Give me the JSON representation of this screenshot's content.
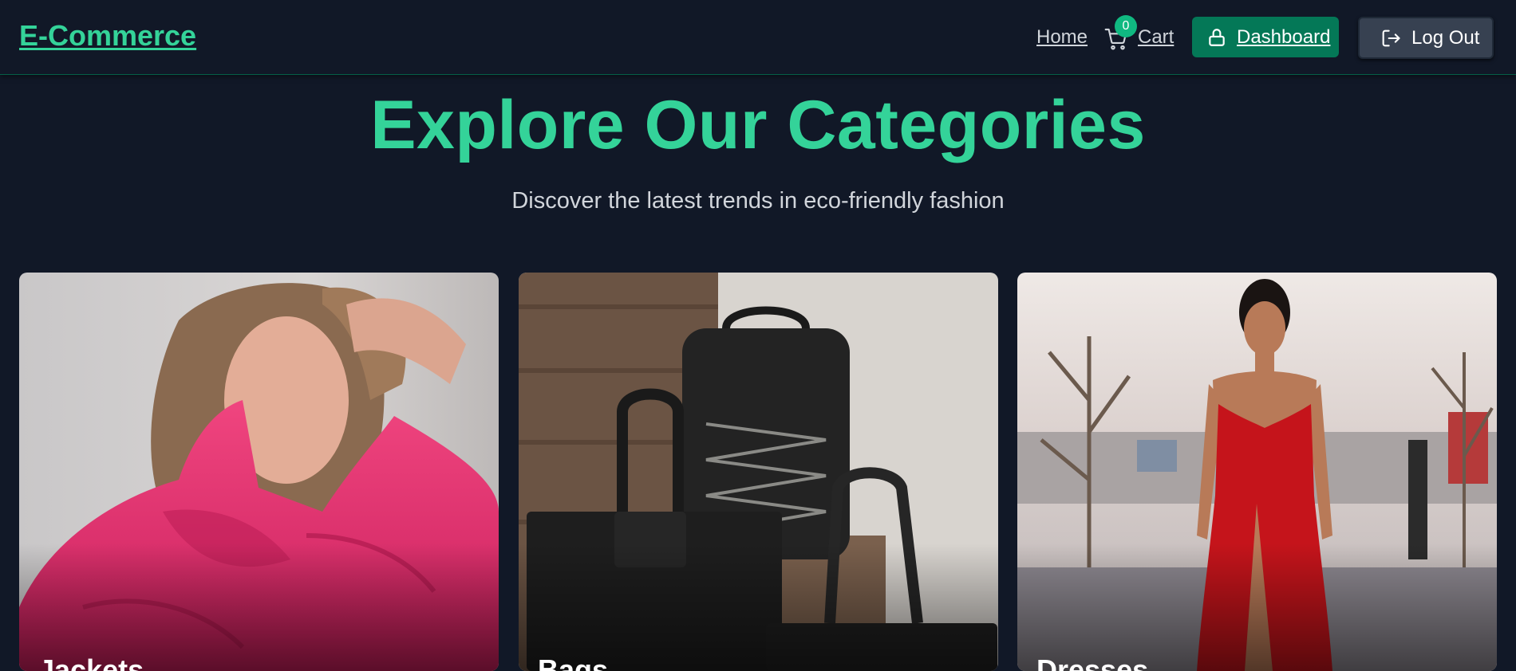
{
  "header": {
    "logo": "E-Commerce",
    "nav": {
      "home": "Home",
      "cart_label": "Cart",
      "cart_count": "0",
      "dashboard": "Dashboard",
      "logout": "Log Out"
    }
  },
  "hero": {
    "title": "Explore Our Categories",
    "subtitle": "Discover the latest trends in eco-friendly fashion"
  },
  "categories": [
    {
      "label": "Jackets",
      "image": "woman-in-pink-puffer-jacket"
    },
    {
      "label": "Bags",
      "image": "black-backpack-and-tote-bags"
    },
    {
      "label": "Dresses",
      "image": "woman-in-red-dress"
    }
  ],
  "colors": {
    "background": "#111827",
    "accent": "#34d399",
    "dashboard_button": "#047857",
    "logout_button": "#374151"
  },
  "icons": [
    "cart-icon",
    "lock-icon",
    "logout-icon"
  ]
}
